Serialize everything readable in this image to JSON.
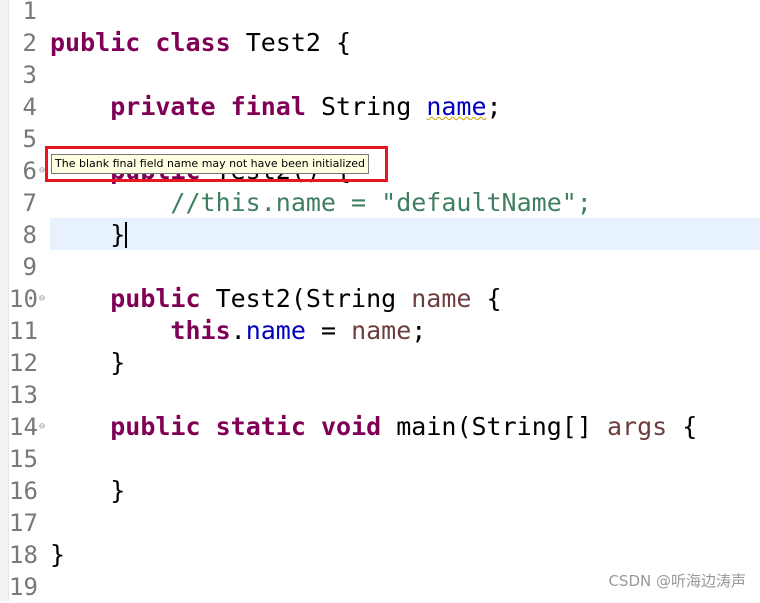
{
  "editor": {
    "current_line": 8,
    "fold_lines": [
      6,
      10,
      14
    ],
    "lines": [
      [],
      [
        [
          "kw",
          "public"
        ],
        [
          "",
          ""
        ],
        [
          "",
          " "
        ],
        [
          "kw",
          "class"
        ],
        [
          "",
          " Test2 {"
        ]
      ],
      [],
      [
        [
          "",
          "    "
        ],
        [
          "kw",
          "private"
        ],
        [
          "",
          " "
        ],
        [
          "kw",
          "final"
        ],
        [
          "",
          " String "
        ],
        [
          "field warn",
          "name"
        ],
        [
          "",
          ";"
        ]
      ],
      [],
      [
        [
          "",
          "    "
        ],
        [
          "kw",
          "public"
        ],
        [
          "",
          " Test2() {"
        ]
      ],
      [
        [
          "",
          "        "
        ],
        [
          "comment",
          "//this.name = \"defaultName\";"
        ]
      ],
      [
        [
          "",
          "    }"
        ]
      ],
      [],
      [
        [
          "",
          "    "
        ],
        [
          "kw",
          "public"
        ],
        [
          "",
          " Test2(String "
        ],
        [
          "param",
          "name"
        ],
        [
          "",
          " {"
        ]
      ],
      [
        [
          "",
          "        "
        ],
        [
          "kw",
          "this"
        ],
        [
          "",
          "."
        ],
        [
          "field",
          "name"
        ],
        [
          "",
          " = "
        ],
        [
          "param",
          "name"
        ],
        [
          "",
          ";"
        ]
      ],
      [
        [
          "",
          "    }"
        ]
      ],
      [],
      [
        [
          "",
          "    "
        ],
        [
          "kw",
          "public"
        ],
        [
          "",
          " "
        ],
        [
          "kw",
          "static"
        ],
        [
          "",
          " "
        ],
        [
          "kw",
          "void"
        ],
        [
          "",
          " main(String[] "
        ],
        [
          "param",
          "args"
        ],
        [
          "",
          " {"
        ]
      ],
      [],
      [
        [
          "",
          "    }"
        ]
      ],
      [],
      [
        [
          "",
          "}"
        ]
      ],
      []
    ]
  },
  "tooltip": {
    "text": "The blank final field name may not have been initialized"
  },
  "watermark": "CSDN @听海边涛声",
  "colors": {
    "keyword": "#7f0055",
    "field": "#0000c0",
    "param": "#6a3e3e",
    "comment": "#3f7f5f",
    "highlight": "#e8f2fe",
    "annotation_box": "#e8161e"
  }
}
